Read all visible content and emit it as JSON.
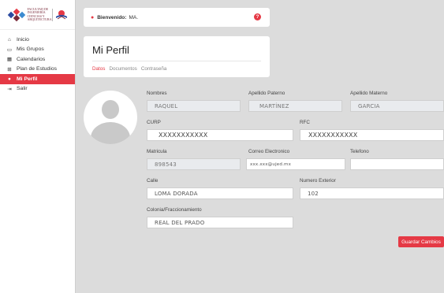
{
  "logo": {
    "name": "FACULTAD DE INGENIERÍA CIENCIAS Y ARQUITECTURA",
    "lines": [
      "FACULTAD DE",
      "INGENIERÍA",
      "CIENCIAS Y",
      "ARQUITECTURA"
    ]
  },
  "sidebar": {
    "items": [
      {
        "label": "Inicio",
        "icon": "home-icon",
        "glyph": "⌂",
        "active": false
      },
      {
        "label": "Mis Grupos",
        "icon": "chalkboard-icon",
        "glyph": "▭",
        "active": false
      },
      {
        "label": "Calendarios",
        "icon": "calendar-icon",
        "glyph": "▦",
        "active": false
      },
      {
        "label": "Plan de Estudios",
        "icon": "book-open-icon",
        "glyph": "⊞",
        "active": false
      },
      {
        "label": "Mi Perfil",
        "icon": "user-icon",
        "glyph": "●",
        "active": true
      },
      {
        "label": "Salir",
        "icon": "sign-out-icon",
        "glyph": "⇥",
        "active": false
      }
    ]
  },
  "header": {
    "greeting_label": "Bienvenido:",
    "user_name": "MA."
  },
  "page": {
    "title": "Mi Perfil",
    "tabs": [
      "Datos",
      "Documentos",
      "Contraseña"
    ],
    "active_tab": "Datos"
  },
  "form": {
    "nombres": {
      "label": "Nombres",
      "value": "RAQUEL"
    },
    "apellido_paterno": {
      "label": "Apellido Paterno",
      "value": "MARTÍNEZ"
    },
    "apellido_materno": {
      "label": "Apellido Materno",
      "value": "GARCIA"
    },
    "curp": {
      "label": "CURP",
      "value": "XXXXXXXXXXX"
    },
    "rfc": {
      "label": "RFC",
      "value": "XXXXXXXXXXX"
    },
    "matricula": {
      "label": "Matricula",
      "value": "898543"
    },
    "correo": {
      "label": "Correo Electronico",
      "value": "xxx.xxx@ujed.mx"
    },
    "telefono": {
      "label": "Telefono",
      "value": ""
    },
    "calle": {
      "label": "Calle",
      "value": "LOMA DORADA"
    },
    "numero_exterior": {
      "label": "Numero Exterior",
      "value": "102"
    },
    "colonia": {
      "label": "Colonia/Fraccionamiento",
      "value": "REAL DEL PRADO"
    }
  },
  "actions": {
    "save_label": "Guardar Cambios"
  },
  "colors": {
    "accent": "#e53945",
    "background": "#dcdcdc",
    "readonly_field": "#e9ebee"
  }
}
